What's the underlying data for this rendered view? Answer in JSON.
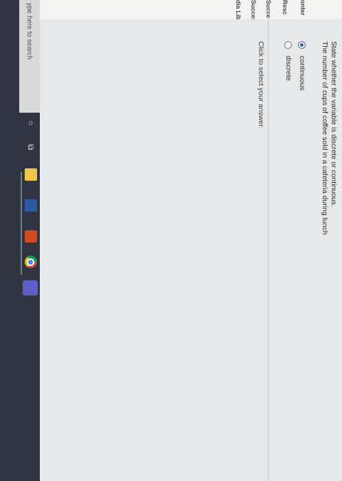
{
  "nav": {
    "items": [
      "onter",
      "Resc",
      "Succe",
      "Succes",
      "dia Lib"
    ]
  },
  "question": {
    "line1": "State whether the variable is discrete or continuous.",
    "line2": "The number of cups of coffee sold in a cafeteria during lunch"
  },
  "options": [
    {
      "label": "continuous",
      "selected": true
    },
    {
      "label": "discrete",
      "selected": false
    }
  ],
  "hint": "Click to select your answer.",
  "taskbar": {
    "search_placeholder": "ype here to search",
    "icons": [
      "cortana-icon",
      "task-view-icon",
      "file-explorer-icon",
      "store-icon",
      "office-icon",
      "chrome-icon",
      "teams-icon"
    ]
  },
  "colors": {
    "accent": "#2f5fa8",
    "taskbar": "#2f3440"
  }
}
